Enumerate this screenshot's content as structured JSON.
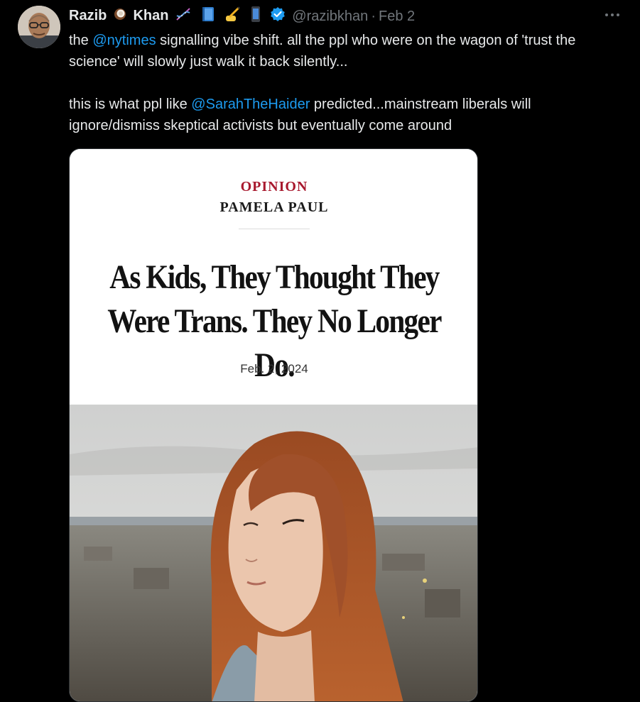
{
  "tweet": {
    "author": {
      "name_first": "Razib",
      "name_last": "Khan",
      "handle": "@razibkhan",
      "verified": true,
      "avatar": "avatar-photo"
    },
    "separator": "·",
    "date": "Feb 2",
    "more_icon": "more-horizontal-icon",
    "text": {
      "line1_pre": "the ",
      "mention1": "@nytimes",
      "line1_post": " signalling vibe shift. all the ppl who were on the wagon of 'trust the science' will slowly just walk it back silently...",
      "line2_pre": "this is what ppl like ",
      "mention2": "@SarahTheHaider",
      "line2_post": " predicted...mainstream liberals will ignore/dismiss skeptical activists but eventually come around"
    },
    "media": {
      "section": "OPINION",
      "author": "PAMELA PAUL",
      "headline": "As Kids, They Thought They Were Trans. They No Longer Do.",
      "date": "Feb. 2, 2024",
      "photo": "portrait-photo"
    },
    "colors": {
      "background": "#000000",
      "text": "#e7e9ea",
      "secondary": "#71767b",
      "link": "#1d9bf0",
      "verified": "#1d9bf0",
      "opinion_red": "#a8192e"
    }
  }
}
